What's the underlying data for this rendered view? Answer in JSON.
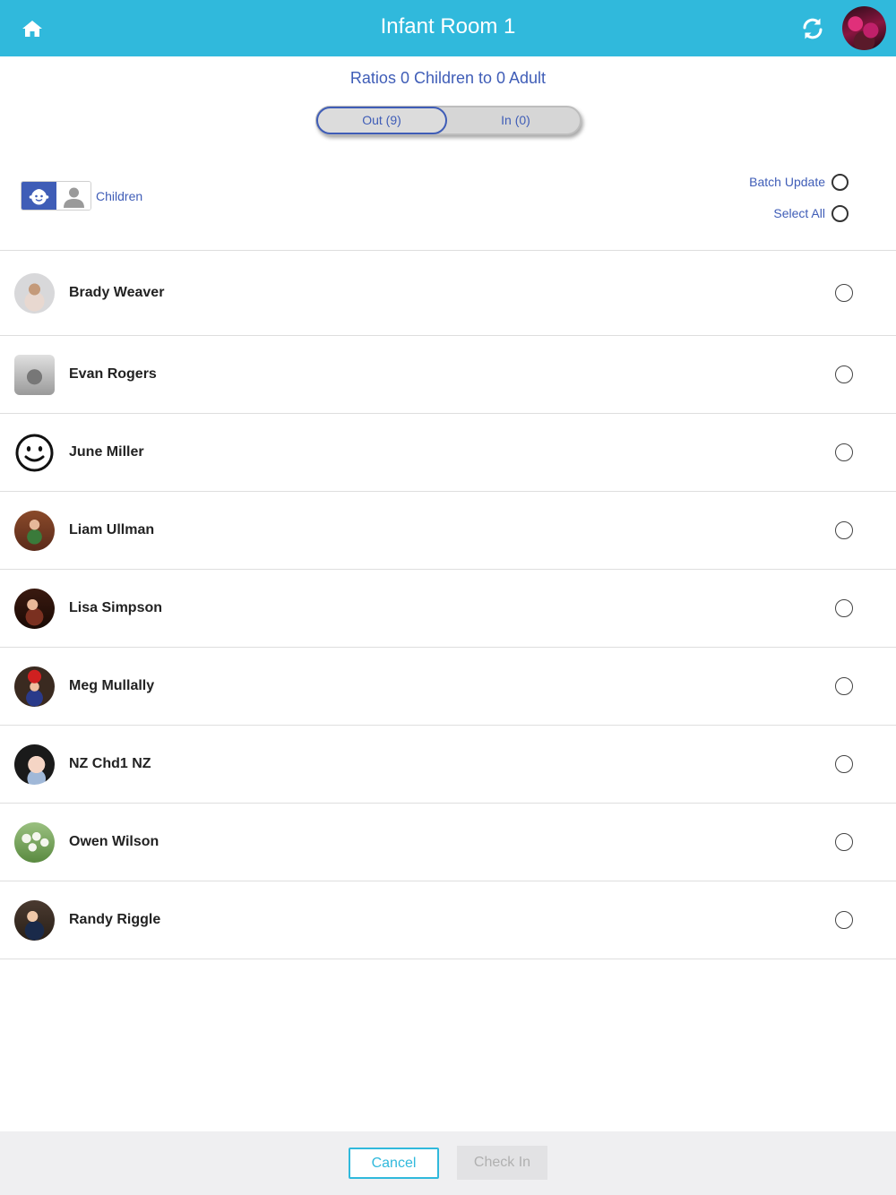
{
  "header": {
    "title": "Infant Room 1",
    "home_icon": "home-icon",
    "refresh_icon": "refresh-icon",
    "bg_color": "#30b9dc"
  },
  "ratios": "Ratios 0 Children to 0 Adult",
  "segment": {
    "out_label": "Out (9)",
    "in_label": "In (0)",
    "selected": "out"
  },
  "filter": {
    "selected": "children",
    "children_icon": "child-face-icon",
    "adult_icon": "person-icon",
    "label": "Children"
  },
  "batch_update": "Batch Update",
  "select_all": "Select All",
  "children": [
    {
      "name": "Brady Weaver"
    },
    {
      "name": "Evan Rogers"
    },
    {
      "name": "June Miller"
    },
    {
      "name": "Liam Ullman"
    },
    {
      "name": "Lisa Simpson"
    },
    {
      "name": "Meg Mullally"
    },
    {
      "name": "NZ Chd1 NZ"
    },
    {
      "name": "Owen Wilson"
    },
    {
      "name": "Randy Riggle"
    }
  ],
  "footer": {
    "cancel_label": "Cancel",
    "checkin_label": "Check In"
  },
  "colors": {
    "accent": "#3f5db7",
    "header": "#30b9dc"
  }
}
